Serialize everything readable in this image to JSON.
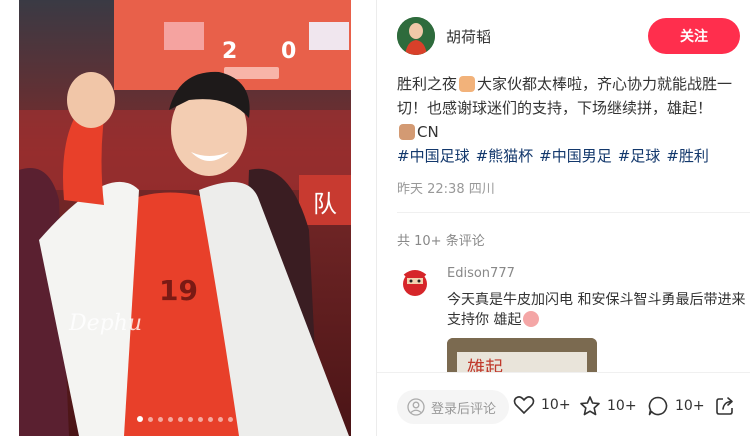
{
  "post": {
    "author": "胡荷韬",
    "follow_label": "关注",
    "content_line1": "胜利之夜",
    "content_line1b": "大家伙都太棒啦，齐心协力就能战胜一切！也感谢球迷们的支持，下场继续拼，雄起！",
    "content_line3": "CN",
    "tags": [
      "#中国足球",
      "#熊猫杯",
      "#中国男足",
      "#足球",
      "#胜利"
    ],
    "meta": "昨天 22:38 四川"
  },
  "photo": {
    "watermark": "Dephu",
    "scoreboard_left": "2",
    "scoreboard_right": "0",
    "banner_text": "队",
    "jersey_number": "19",
    "dots_count": 10,
    "active_dot": 0
  },
  "comments": {
    "count_label": "共 10+ 条评论",
    "items": [
      {
        "name": "Edison777",
        "text": "今天真是牛皮加闪电 和安保斗智斗勇最后带进来支持你 雄起",
        "image_text": "雄起"
      }
    ]
  },
  "footer": {
    "login_placeholder": "登录后评论",
    "likes": "10+",
    "collects": "10+",
    "comments": "10+"
  },
  "colors": {
    "accent": "#ff2e4d",
    "tag": "#13386c"
  }
}
